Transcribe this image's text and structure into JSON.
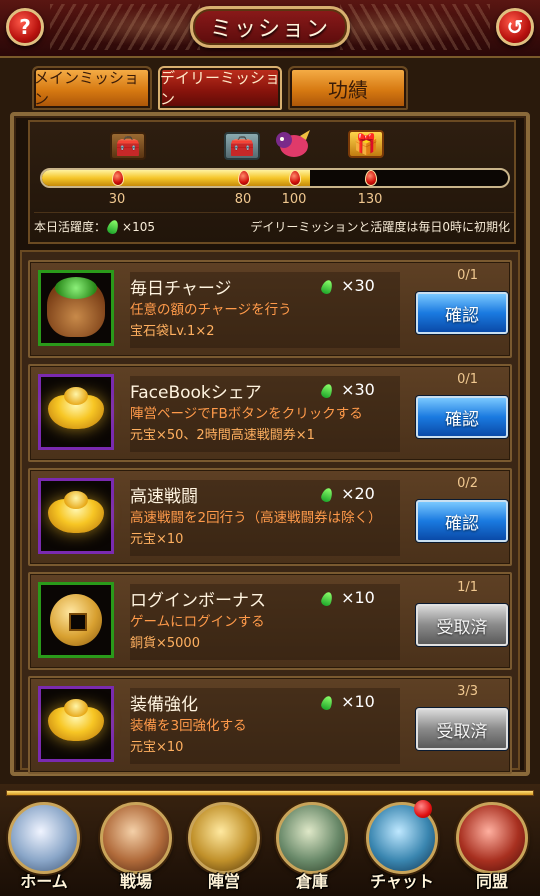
{
  "header": {
    "title": "ミッション",
    "help_icon": "?",
    "back_icon": "↺"
  },
  "tabs": [
    {
      "label": "メインミッション",
      "active": false
    },
    {
      "label": "デイリーミッション",
      "active": true
    },
    {
      "label": "功績",
      "active": false
    }
  ],
  "activity": {
    "current": 105,
    "progress_ratio": 0.575,
    "milestones": [
      "30",
      "80",
      "100",
      "130"
    ],
    "label": "本日活躍度：",
    "value_text": "×105",
    "notice": "デイリーミッションと活躍度は毎日0時に初期化"
  },
  "missions": [
    {
      "name": "毎日チャージ",
      "desc": "任意の額のチャージを行う",
      "reward": "宝石袋Lv.1×2",
      "points": "×30",
      "progress": "0/1",
      "button": "確認",
      "state": "confirm",
      "icon": "gem-bag-icon"
    },
    {
      "name": "FaceBookシェア",
      "desc": "陣営ページでFBボタンをクリックする",
      "reward": "元宝×50、2時間高速戦闘券×1",
      "points": "×30",
      "progress": "0/1",
      "button": "確認",
      "state": "confirm",
      "icon": "gold-ingot-icon"
    },
    {
      "name": "高速戦闘",
      "desc": "高速戦闘を2回行う（高速戦闘券は除く）",
      "reward": "元宝×10",
      "points": "×20",
      "progress": "0/2",
      "button": "確認",
      "state": "confirm",
      "icon": "gold-ingot-icon"
    },
    {
      "name": "ログインボーナス",
      "desc": "ゲームにログインする",
      "reward": "銅貨×5000",
      "points": "×10",
      "progress": "1/1",
      "button": "受取済",
      "state": "claimed",
      "icon": "copper-coin-icon"
    },
    {
      "name": "装備強化",
      "desc": "装備を3回強化する",
      "reward": "元宝×10",
      "points": "×10",
      "progress": "3/3",
      "button": "受取済",
      "state": "claimed",
      "icon": "gold-ingot-icon"
    }
  ],
  "nav": [
    {
      "label": "ホーム",
      "color": "#8aa6c8"
    },
    {
      "label": "戦場",
      "color": "#b06a3a"
    },
    {
      "label": "陣営",
      "color": "#c0902a"
    },
    {
      "label": "倉庫",
      "color": "#6a8a6a"
    },
    {
      "label": "チャット",
      "color": "#3a86b0"
    },
    {
      "label": "同盟",
      "color": "#a83020"
    }
  ]
}
